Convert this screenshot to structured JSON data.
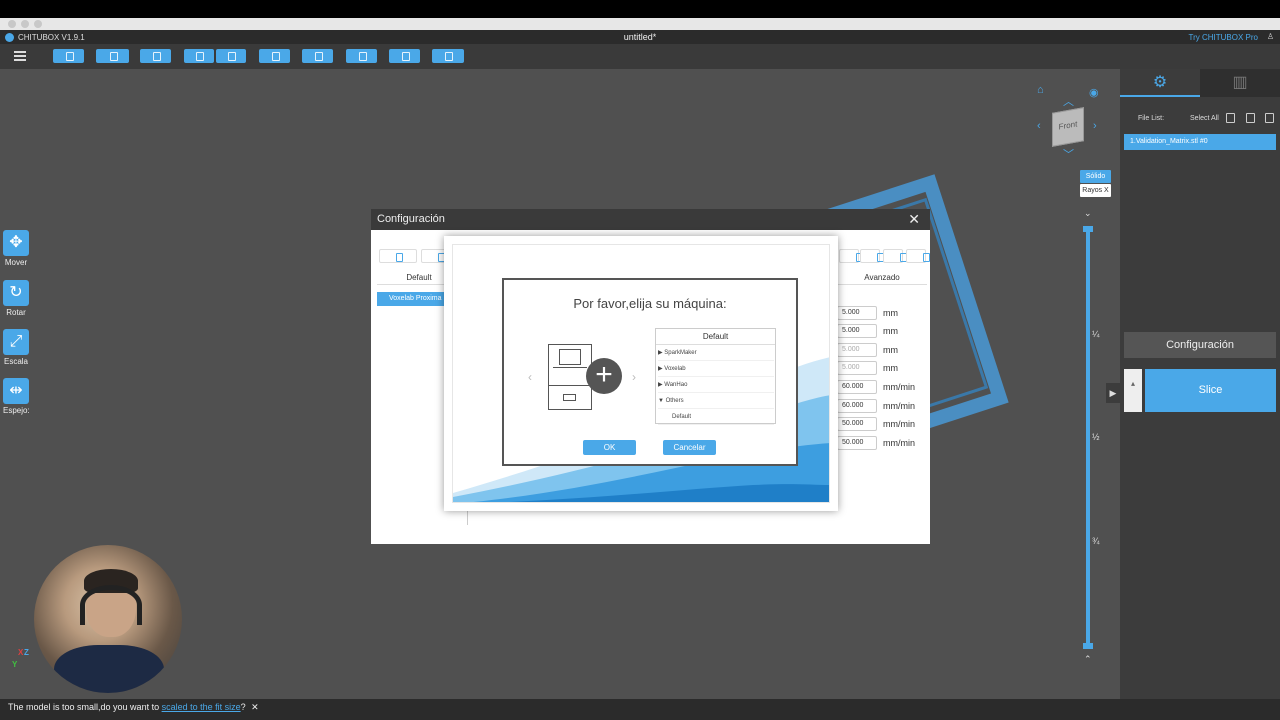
{
  "window": {
    "app_name": "CHITUBOX V1.9.1",
    "document_title": "untitled*",
    "try_pro": "Try CHITUBOX Pro"
  },
  "left_tools": [
    {
      "label": "Mover",
      "icon": "move-icon"
    },
    {
      "label": "Rotar",
      "icon": "rotate-icon"
    },
    {
      "label": "Escala",
      "icon": "scale-icon"
    },
    {
      "label": "Espejo:",
      "icon": "mirror-icon"
    }
  ],
  "right_panel": {
    "file_list_label": "File List:",
    "select_all_label": "Select All",
    "file_item": "1.Validation_Matrix.stl #0",
    "config_button": "Configuración",
    "slice_button": "Slice"
  },
  "view": {
    "solid_label": "Sólido",
    "xray_label": "Rayos X",
    "cube_label": "Front",
    "ticks": [
      "¼",
      "½",
      "¾"
    ]
  },
  "config_dialog": {
    "title": "Configuración",
    "tab_default": "Default",
    "tab_advanced": "Avanzado",
    "profile_selected": "Voxelab Proxima",
    "fields": [
      {
        "value": "5.000",
        "unit": "mm",
        "disabled": false
      },
      {
        "value": "5.000",
        "unit": "mm",
        "disabled": false
      },
      {
        "value": "5.000",
        "unit": "mm",
        "disabled": true
      },
      {
        "value": "5.000",
        "unit": "mm",
        "disabled": true
      },
      {
        "value": "60.000",
        "unit": "mm/min",
        "disabled": false
      },
      {
        "value": "60.000",
        "unit": "mm/min",
        "disabled": false
      },
      {
        "value": "50.000",
        "unit": "mm/min",
        "disabled": false
      },
      {
        "value": "50.000",
        "unit": "mm/min",
        "disabled": false
      }
    ]
  },
  "machine_dialog": {
    "title": "Por favor,elija su máquina:",
    "list_header": "Default",
    "items": [
      {
        "label": "▶ SparkMaker"
      },
      {
        "label": "▶ Voxelab"
      },
      {
        "label": "▶ WanHao"
      },
      {
        "label": "▼ Others"
      },
      {
        "label": "Default"
      }
    ],
    "ok_label": "OK",
    "cancel_label": "Cancelar",
    "prev_arrow": "‹",
    "next_arrow": "›"
  },
  "status_bar": {
    "message": "The model is too small,do you want to ",
    "link": "scaled to the fit size",
    "suffix": "?",
    "close": "✕"
  },
  "colors": {
    "accent": "#4aa8e8",
    "background": "#505050",
    "panel": "#3c3c3c"
  }
}
